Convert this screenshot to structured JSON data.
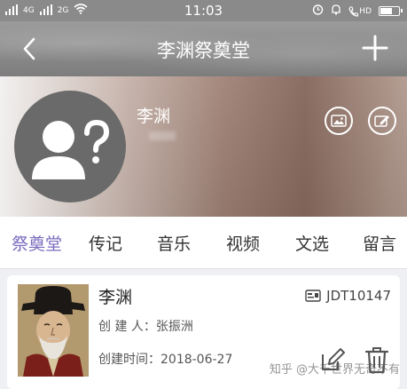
{
  "status_bar": {
    "network_left": "4G",
    "network_right": "2G",
    "time": "11:03",
    "hd_label": "HD"
  },
  "header": {
    "title": "李渊祭奠堂"
  },
  "hero": {
    "name": "李渊"
  },
  "tabs": [
    {
      "label": "祭奠堂",
      "active": true
    },
    {
      "label": "传记",
      "active": false
    },
    {
      "label": "音乐",
      "active": false
    },
    {
      "label": "视频",
      "active": false
    },
    {
      "label": "文选",
      "active": false
    },
    {
      "label": "留言",
      "active": false
    }
  ],
  "record": {
    "name": "李渊",
    "id": "JDT10147",
    "creator_text": "创 建 人：张振洲",
    "date_text": "创建时间：2018-06-27"
  },
  "watermark": "知乎 @大千世界无奇不有",
  "colors": {
    "accent": "#7b6bbf",
    "title_bar": "#8a8a8a"
  }
}
